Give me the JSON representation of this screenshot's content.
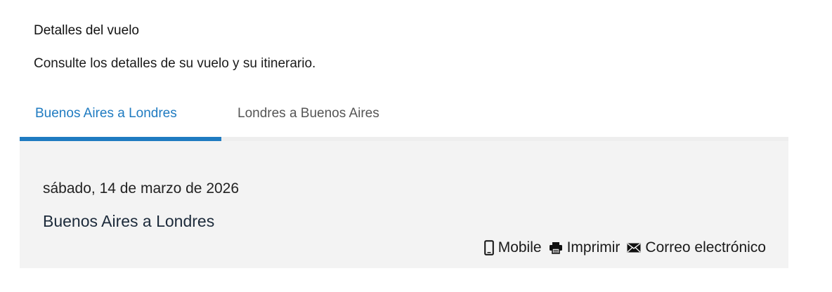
{
  "header": {
    "title": "Detalles del vuelo",
    "subtitle": "Consulte los detalles de su vuelo y su itinerario."
  },
  "tabs": [
    {
      "label": "Buenos Aires a Londres",
      "active": true
    },
    {
      "label": "Londres a Buenos Aires",
      "active": false
    }
  ],
  "flight": {
    "date": "sábado, 14 de marzo de 2026",
    "route": "Buenos Aires a Londres"
  },
  "actions": {
    "mobile_label": "Mobile",
    "print_label": "Imprimir",
    "email_label": "Correo electrónico",
    "icons": [
      "mobile-icon",
      "printer-icon",
      "envelope-icon"
    ]
  },
  "colors": {
    "accent": "#1f7bc1",
    "panel_bg": "#f3f3f3",
    "track": "#eeeeee"
  }
}
